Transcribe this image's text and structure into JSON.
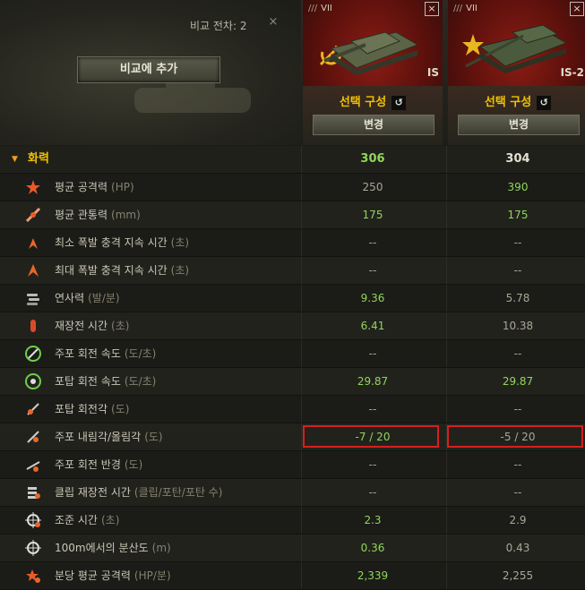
{
  "compare": {
    "count_label": "비교 전차: 2",
    "close": "×",
    "add_button": "비교에 추가"
  },
  "tanks": [
    {
      "tier": "VII",
      "name": "IS",
      "config": "선택 구성",
      "change": "변경",
      "close": "×"
    },
    {
      "tier": "VII",
      "name": "IS-2",
      "config": "선택 구성",
      "change": "변경",
      "close": "×"
    }
  ],
  "section": {
    "label": "화력",
    "values": [
      "306",
      "304"
    ]
  },
  "rows": [
    {
      "label": "평균 공격력",
      "unit": "(HP)",
      "icon": "damage-icon",
      "v": [
        "250",
        "390"
      ],
      "g": [
        false,
        true
      ]
    },
    {
      "label": "평균 관통력",
      "unit": "(mm)",
      "icon": "penetration-icon",
      "v": [
        "175",
        "175"
      ],
      "g": [
        true,
        true
      ]
    },
    {
      "label": "최소 폭발 충격 지속 시간",
      "unit": "(초)",
      "icon": "stun-min-icon",
      "v": [
        "--",
        "--"
      ],
      "g": [
        false,
        false
      ]
    },
    {
      "label": "최대 폭발 충격 지속 시간",
      "unit": "(초)",
      "icon": "stun-max-icon",
      "v": [
        "--",
        "--"
      ],
      "g": [
        false,
        false
      ]
    },
    {
      "label": "연사력",
      "unit": "(발/분)",
      "icon": "rate-of-fire-icon",
      "v": [
        "9.36",
        "5.78"
      ],
      "g": [
        true,
        false
      ]
    },
    {
      "label": "재장전 시간",
      "unit": "(초)",
      "icon": "reload-icon",
      "v": [
        "6.41",
        "10.38"
      ],
      "g": [
        true,
        false
      ]
    },
    {
      "label": "주포 회전 속도",
      "unit": "(도/초)",
      "icon": "gun-traverse-icon",
      "v": [
        "--",
        "--"
      ],
      "g": [
        false,
        false
      ]
    },
    {
      "label": "포탑 회전 속도",
      "unit": "(도/초)",
      "icon": "turret-traverse-icon",
      "v": [
        "29.87",
        "29.87"
      ],
      "g": [
        true,
        true
      ]
    },
    {
      "label": "포탑 회전각",
      "unit": "(도)",
      "icon": "turret-arc-icon",
      "v": [
        "--",
        "--"
      ],
      "g": [
        false,
        false
      ]
    },
    {
      "label": "주포 내림각/올림각",
      "unit": "(도)",
      "icon": "elevation-icon",
      "v": [
        "-7 / 20",
        "-5 / 20"
      ],
      "g": [
        true,
        false
      ],
      "highlight": true
    },
    {
      "label": "주포 회전 반경",
      "unit": "(도)",
      "icon": "gun-arc-icon",
      "v": [
        "--",
        "--"
      ],
      "g": [
        false,
        false
      ]
    },
    {
      "label": "클립 재장전 시간",
      "unit": "(클립/포탄/포탄 수)",
      "icon": "clip-icon",
      "v": [
        "--",
        "--"
      ],
      "g": [
        false,
        false
      ]
    },
    {
      "label": "조준 시간",
      "unit": "(초)",
      "icon": "aim-time-icon",
      "v": [
        "2.3",
        "2.9"
      ],
      "g": [
        true,
        false
      ]
    },
    {
      "label": "100m에서의 분산도",
      "unit": "(m)",
      "icon": "dispersion-icon",
      "v": [
        "0.36",
        "0.43"
      ],
      "g": [
        true,
        false
      ]
    },
    {
      "label": "분당 평균 공격력",
      "unit": "(HP/분)",
      "icon": "dpm-icon",
      "v": [
        "2,339",
        "2,255"
      ],
      "g": [
        true,
        false
      ]
    }
  ]
}
